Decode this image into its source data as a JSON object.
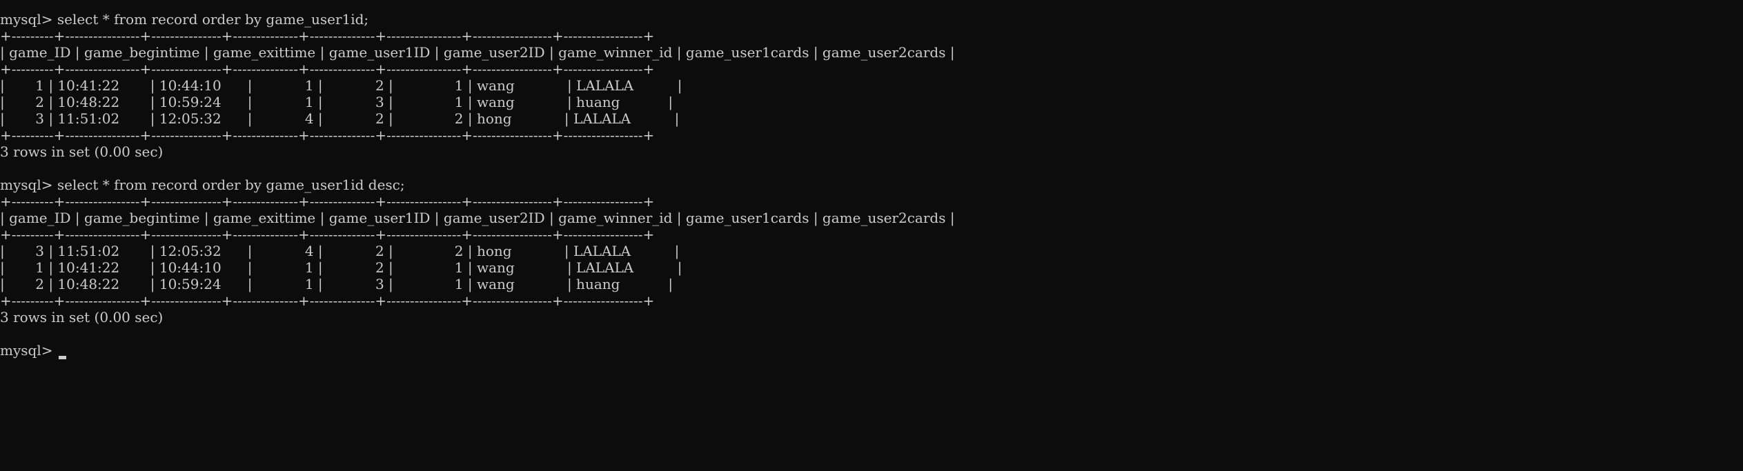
{
  "session": [
    "mysql> select * from record order by game_user1id;",
    "+---------+----------------+---------------+--------------+--------------+----------------+-----------------+-----------------+",
    "| game_ID | game_begintime | game_exittime | game_user1ID | game_user2ID | game_winner_id | game_user1cards | game_user2cards |",
    "+---------+----------------+---------------+--------------+--------------+----------------+-----------------+-----------------+",
    "|       1 | 10:41:22       | 10:44:10      |            1 |            2 |              1 | wang            | LALALA          |",
    "|       2 | 10:48:22       | 10:59:24      |            1 |            3 |              1 | wang            | huang           |",
    "|       3 | 11:51:02       | 12:05:32      |            4 |            2 |              2 | hong            | LALALA          |",
    "+---------+----------------+---------------+--------------+--------------+----------------+-----------------+-----------------+",
    "3 rows in set (0.00 sec)",
    "",
    "mysql> select * from record order by game_user1id desc;",
    "+---------+----------------+---------------+--------------+--------------+----------------+-----------------+-----------------+",
    "| game_ID | game_begintime | game_exittime | game_user1ID | game_user2ID | game_winner_id | game_user1cards | game_user2cards |",
    "+---------+----------------+---------------+--------------+--------------+----------------+-----------------+-----------------+",
    "|       3 | 11:51:02       | 12:05:32      |            4 |            2 |              2 | hong            | LALALA          |",
    "|       1 | 10:41:22       | 10:44:10      |            1 |            2 |              1 | wang            | LALALA          |",
    "|       2 | 10:48:22       | 10:59:24      |            1 |            3 |              1 | wang            | huang           |",
    "+---------+----------------+---------------+--------------+--------------+----------------+-----------------+-----------------+",
    "3 rows in set (0.00 sec)",
    "",
    "mysql> "
  ]
}
